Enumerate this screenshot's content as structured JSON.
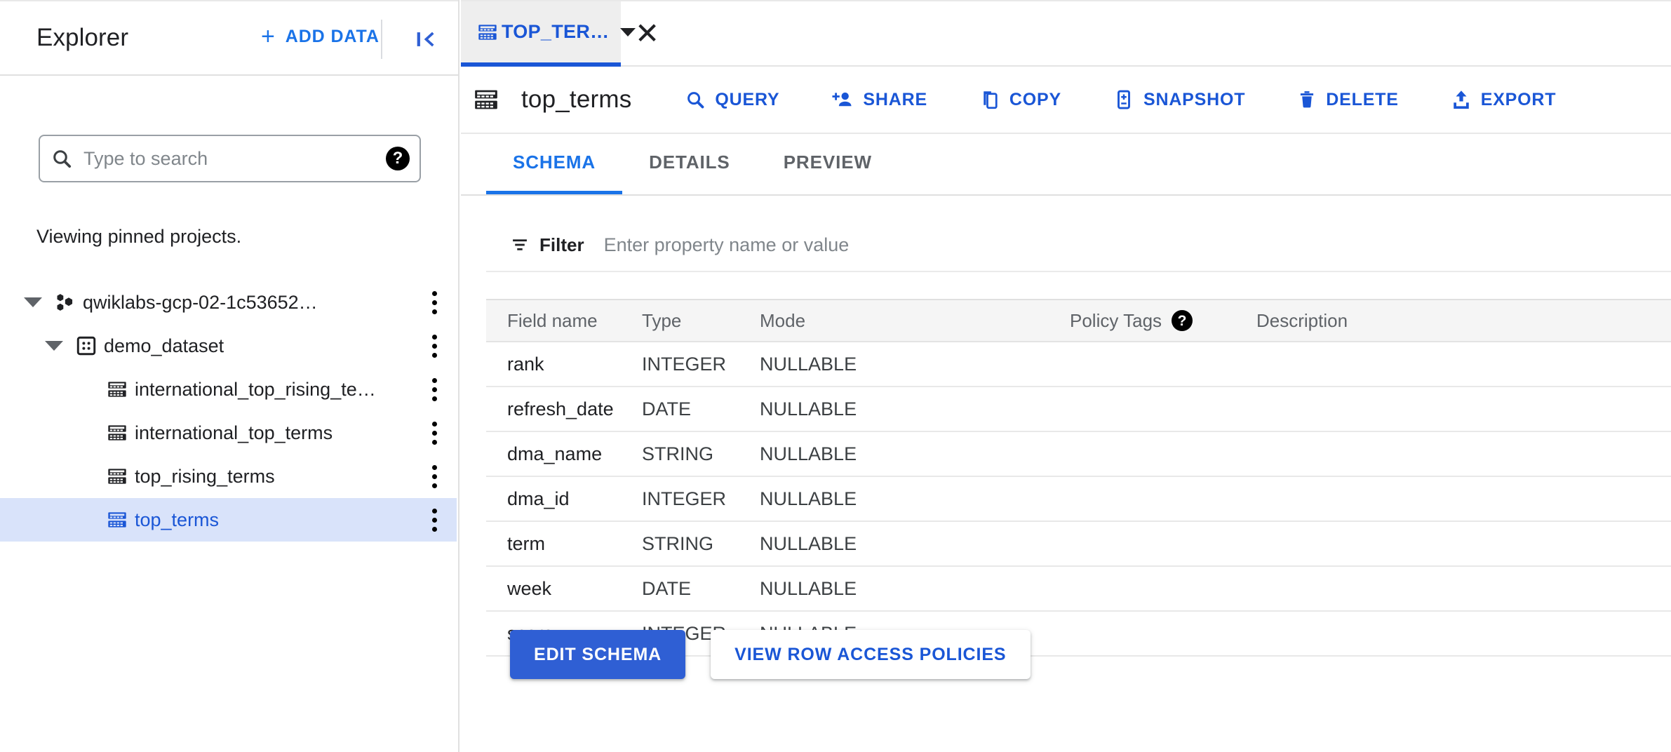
{
  "sidebar": {
    "title": "Explorer",
    "add_data_label": "ADD DATA",
    "add_data_icon": "plus-icon",
    "collapse_icon": "collapse-panel-icon",
    "search": {
      "placeholder": "Type to search",
      "value": "",
      "icon": "search-icon",
      "help_icon": "help-icon"
    },
    "pinned_note": "Viewing pinned projects.",
    "tree": [
      {
        "label": "qwiklabs-gcp-02-1c53652…",
        "level": "project",
        "icon": "project-icon",
        "expanded": true,
        "selected": false,
        "menu_icon": "more-vert-icon"
      },
      {
        "label": "demo_dataset",
        "level": "dataset",
        "icon": "dataset-icon",
        "expanded": true,
        "selected": false,
        "menu_icon": "more-vert-icon"
      },
      {
        "label": "international_top_rising_te…",
        "level": "table",
        "icon": "table-icon",
        "expanded": false,
        "selected": false,
        "menu_icon": "more-vert-icon"
      },
      {
        "label": "international_top_terms",
        "level": "table",
        "icon": "table-icon",
        "expanded": false,
        "selected": false,
        "menu_icon": "more-vert-icon"
      },
      {
        "label": "top_rising_terms",
        "level": "table",
        "icon": "table-icon",
        "expanded": false,
        "selected": false,
        "menu_icon": "more-vert-icon"
      },
      {
        "label": "top_terms",
        "level": "table",
        "icon": "table-icon",
        "expanded": false,
        "selected": true,
        "menu_icon": "more-vert-icon"
      }
    ]
  },
  "tabstrip": {
    "tab_label": "TOP_TER…",
    "tab_icon": "table-icon",
    "caret_icon": "chevron-down-icon",
    "close_icon": "close-icon"
  },
  "toolbar": {
    "table_icon": "table-icon",
    "table_name": "top_terms",
    "actions": [
      {
        "label": "QUERY",
        "icon": "search-icon"
      },
      {
        "label": "SHARE",
        "icon": "person-add-icon"
      },
      {
        "label": "COPY",
        "icon": "copy-icon"
      },
      {
        "label": "SNAPSHOT",
        "icon": "snapshot-icon"
      },
      {
        "label": "DELETE",
        "icon": "trash-icon"
      },
      {
        "label": "EXPORT",
        "icon": "export-icon"
      }
    ]
  },
  "section_tabs": [
    {
      "label": "SCHEMA",
      "active": true
    },
    {
      "label": "DETAILS",
      "active": false
    },
    {
      "label": "PREVIEW",
      "active": false
    }
  ],
  "filter": {
    "icon": "filter-icon",
    "label": "Filter",
    "placeholder": "Enter property name or value",
    "value": ""
  },
  "schema": {
    "columns": [
      "Field name",
      "Type",
      "Mode",
      "Policy Tags",
      "Description"
    ],
    "policy_tags_help_icon": "help-icon",
    "rows": [
      {
        "field": "rank",
        "type": "INTEGER",
        "mode": "NULLABLE",
        "policy_tags": "",
        "description": ""
      },
      {
        "field": "refresh_date",
        "type": "DATE",
        "mode": "NULLABLE",
        "policy_tags": "",
        "description": ""
      },
      {
        "field": "dma_name",
        "type": "STRING",
        "mode": "NULLABLE",
        "policy_tags": "",
        "description": ""
      },
      {
        "field": "dma_id",
        "type": "INTEGER",
        "mode": "NULLABLE",
        "policy_tags": "",
        "description": ""
      },
      {
        "field": "term",
        "type": "STRING",
        "mode": "NULLABLE",
        "policy_tags": "",
        "description": ""
      },
      {
        "field": "week",
        "type": "DATE",
        "mode": "NULLABLE",
        "policy_tags": "",
        "description": ""
      },
      {
        "field": "score",
        "type": "INTEGER",
        "mode": "NULLABLE",
        "policy_tags": "",
        "description": ""
      }
    ]
  },
  "bottom_actions": {
    "edit_schema_label": "EDIT SCHEMA",
    "view_policies_label": "VIEW ROW ACCESS POLICIES"
  },
  "colors": {
    "accent_blue": "#1a73e8",
    "tab_blue": "#1a56d6",
    "primary_button": "#2f5fd4",
    "selected_row_bg": "#d9e3fa",
    "header_row_bg": "#f5f5f5",
    "text_primary": "#202124",
    "text_secondary": "#5f6368"
  }
}
